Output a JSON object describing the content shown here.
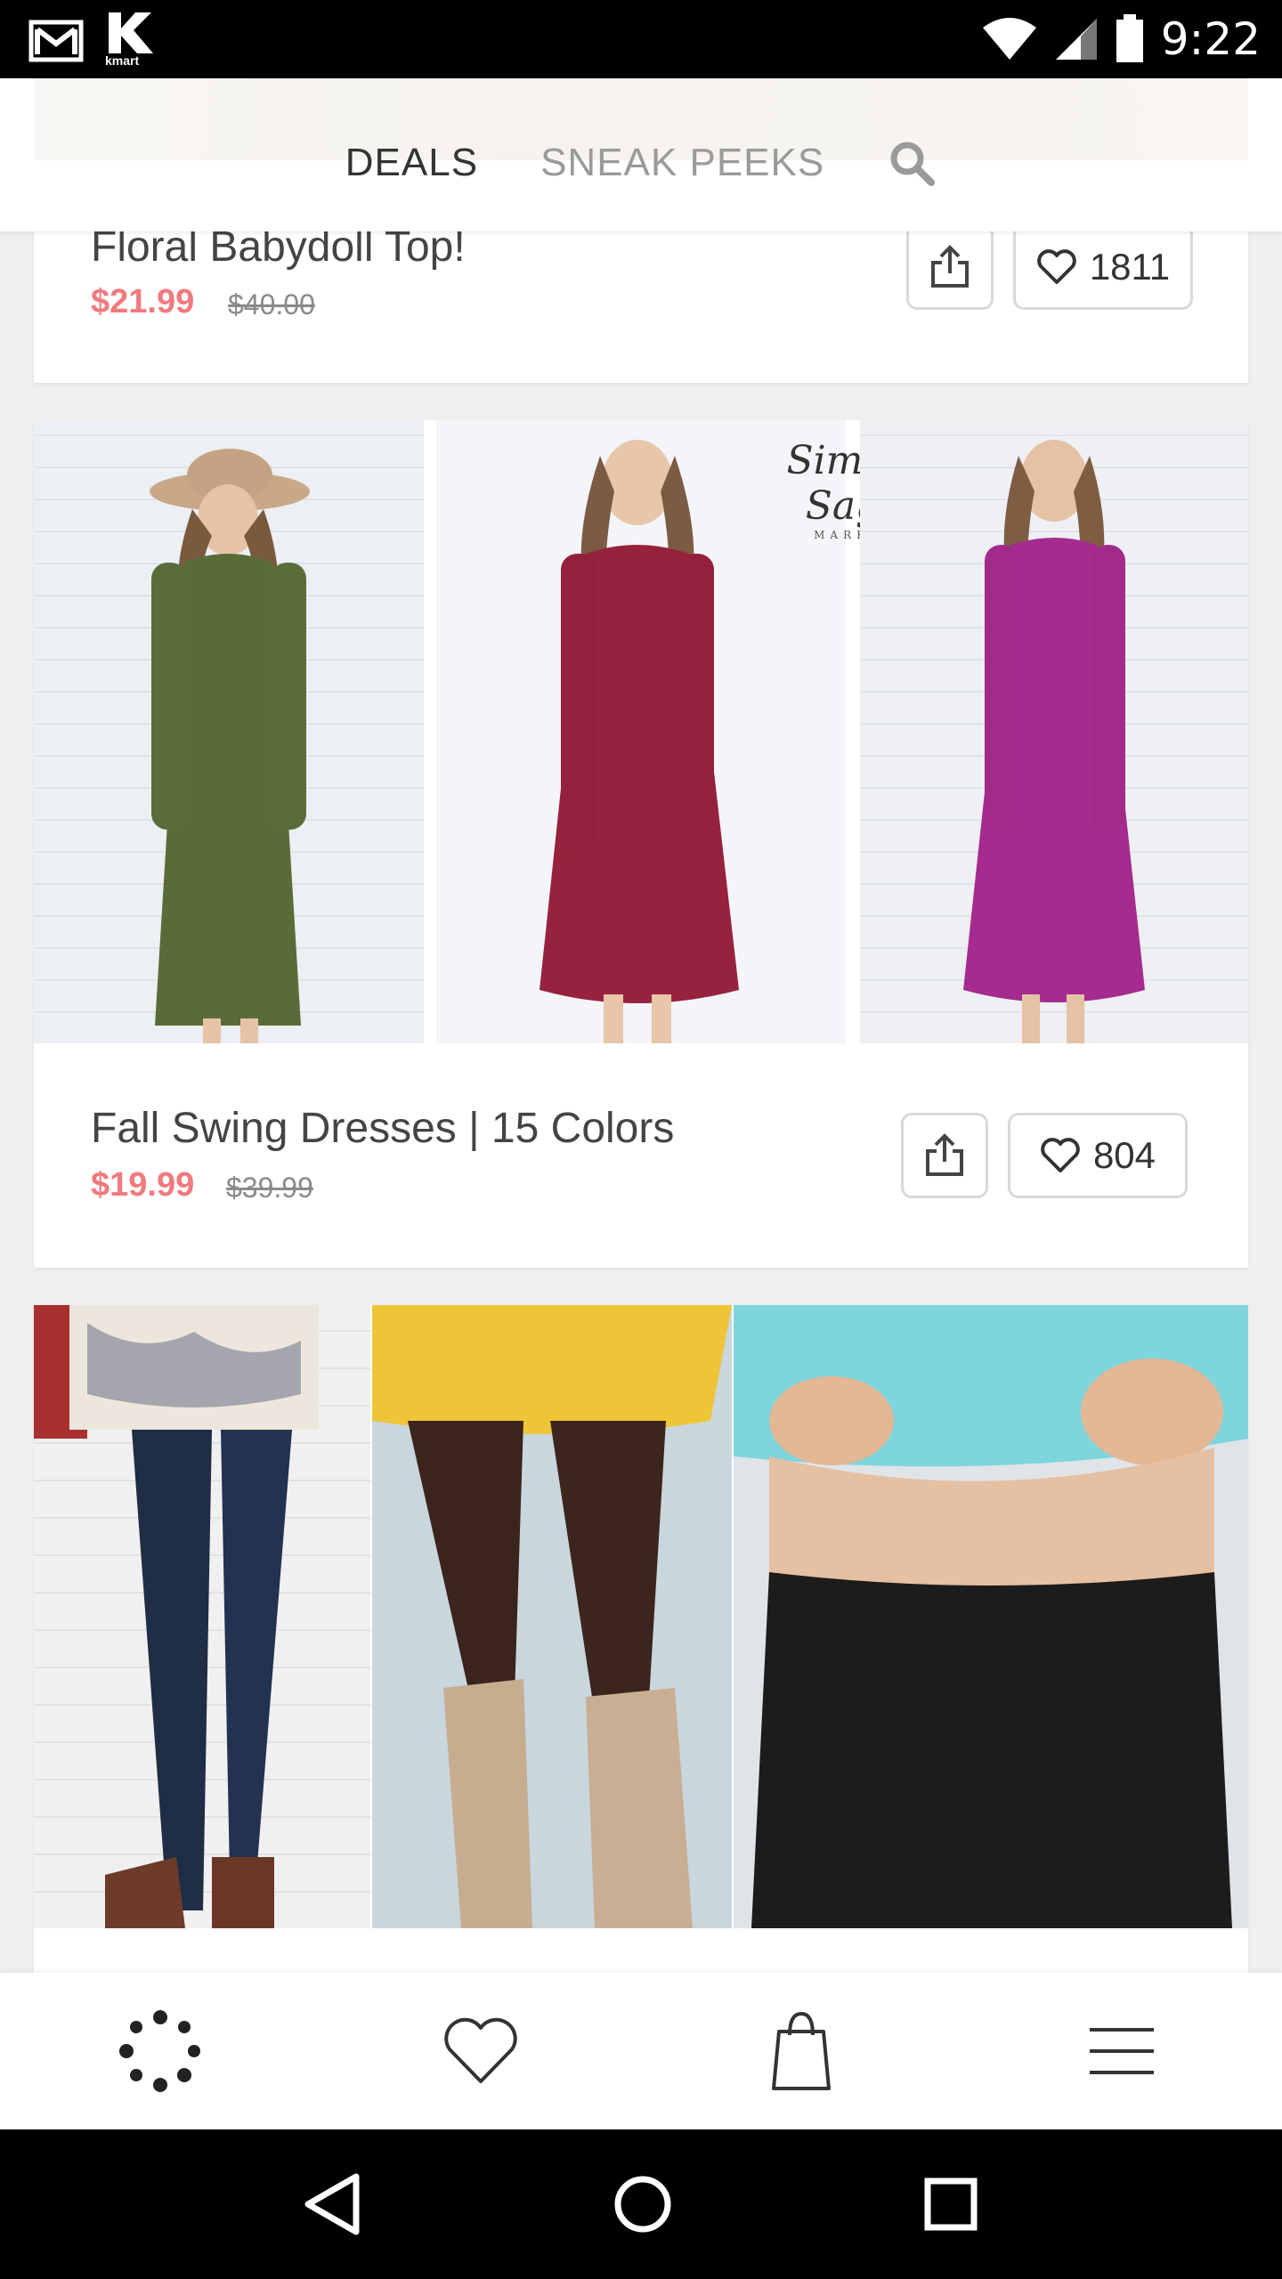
{
  "status_bar": {
    "time": "9:22",
    "left_icons": [
      "gmail-icon",
      "kmart-icon"
    ],
    "kmart_label": "kmart",
    "right_icons": [
      "wifi-icon",
      "signal-icon",
      "battery-icon"
    ]
  },
  "header": {
    "tabs": [
      {
        "label": "DEALS",
        "active": true
      },
      {
        "label": "SNEAK PEEKS",
        "active": false
      }
    ],
    "search_icon": "search-icon"
  },
  "products": [
    {
      "title": "Floral Babydoll Top!",
      "price": "$21.99",
      "original_price": "$40.00",
      "likes": "1811"
    },
    {
      "title": "Fall Swing Dresses | 15 Colors",
      "price": "$19.99",
      "original_price": "$39.99",
      "likes": "804",
      "watermark": "Simply Sage",
      "watermark_sub": "MARKET"
    },
    {
      "title": "",
      "price": "",
      "original_price": "",
      "likes": ""
    }
  ],
  "bottom_nav": {
    "items": [
      "deals-spinner-icon",
      "favorites-heart-icon",
      "shopping-bag-icon",
      "menu-icon"
    ]
  },
  "android_nav": [
    "back-icon",
    "home-icon",
    "recents-icon"
  ],
  "colors": {
    "accent_price": "#f07a7e",
    "status_bar": "#000000",
    "tab_active": "#333333",
    "tab_inactive": "#9a9a9a"
  }
}
